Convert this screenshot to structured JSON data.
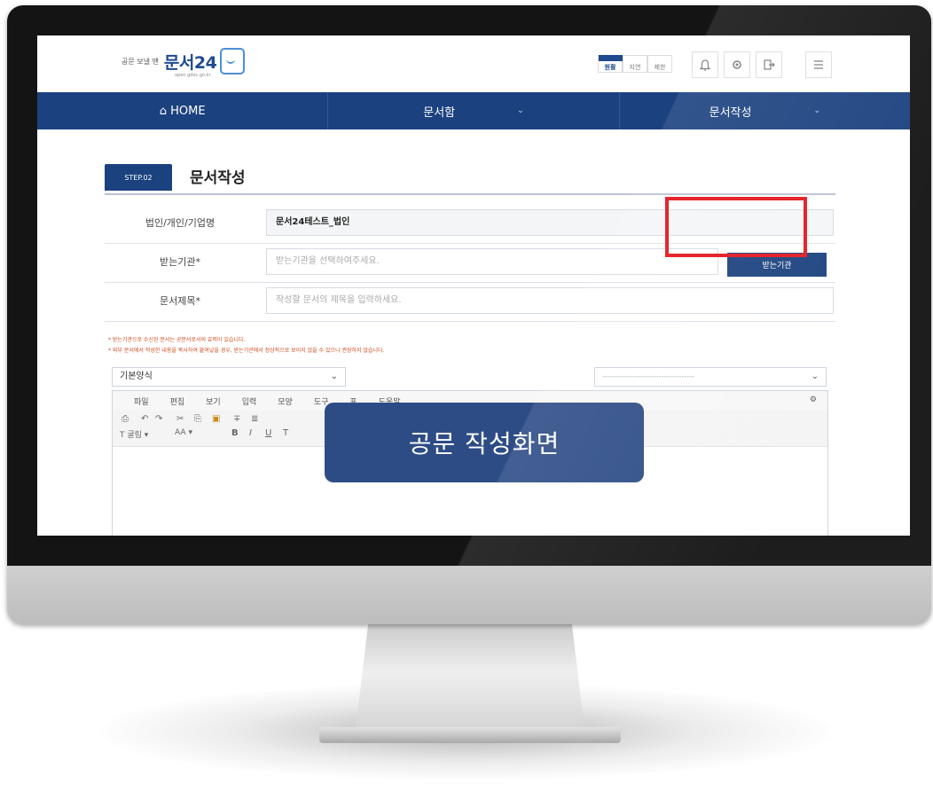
{
  "header": {
    "brand_tagline": "공문 보낼 땐",
    "brand_name": "문서24",
    "brand_url": "open.gdoc.go.kr",
    "text_size": [
      "원활",
      "지연",
      "제한"
    ],
    "icons": [
      "bell-icon",
      "gear-icon",
      "logout-icon",
      "menu-icon"
    ]
  },
  "nav": {
    "items": [
      {
        "label": "⌂ HOME"
      },
      {
        "label": "문서함"
      },
      {
        "label": "문서작성"
      }
    ]
  },
  "step": {
    "badge": "STEP.02",
    "title": "문서작성"
  },
  "form": {
    "sender_label": "법인/개인/기업명",
    "sender_value": "문서24테스트_법인",
    "receiver_label": "받는기관*",
    "receiver_placeholder": "받는기관을 선택하여주세요.",
    "receiver_button": "받는기관",
    "subject_label": "문서제목*",
    "subject_placeholder": "작성할 문서의 제목을 입력하세요."
  },
  "notices": [
    "* 받는기관으로 수신된 문서는 공문서로서의 효력이 있습니다.",
    "* 외부 문서에서 작성한 내용을 복사하여 붙여넣을 경우, 받는기관에서 정상적으로 보이지 않을 수 있으니 권장하지 않습니다."
  ],
  "template_select": "기본양식",
  "secondary_select": "------------------------------------",
  "editor": {
    "menus": [
      "파일",
      "편집",
      "보기",
      "입력",
      "모양",
      "도구",
      "표",
      "도움말"
    ],
    "font_name": "굴림",
    "font_size": "AA"
  },
  "overlay_caption": "공문 작성화면",
  "colors": {
    "brand_navy": "#1b417f",
    "highlight_red": "#e5262c",
    "notice_orange": "#d04a1e"
  }
}
